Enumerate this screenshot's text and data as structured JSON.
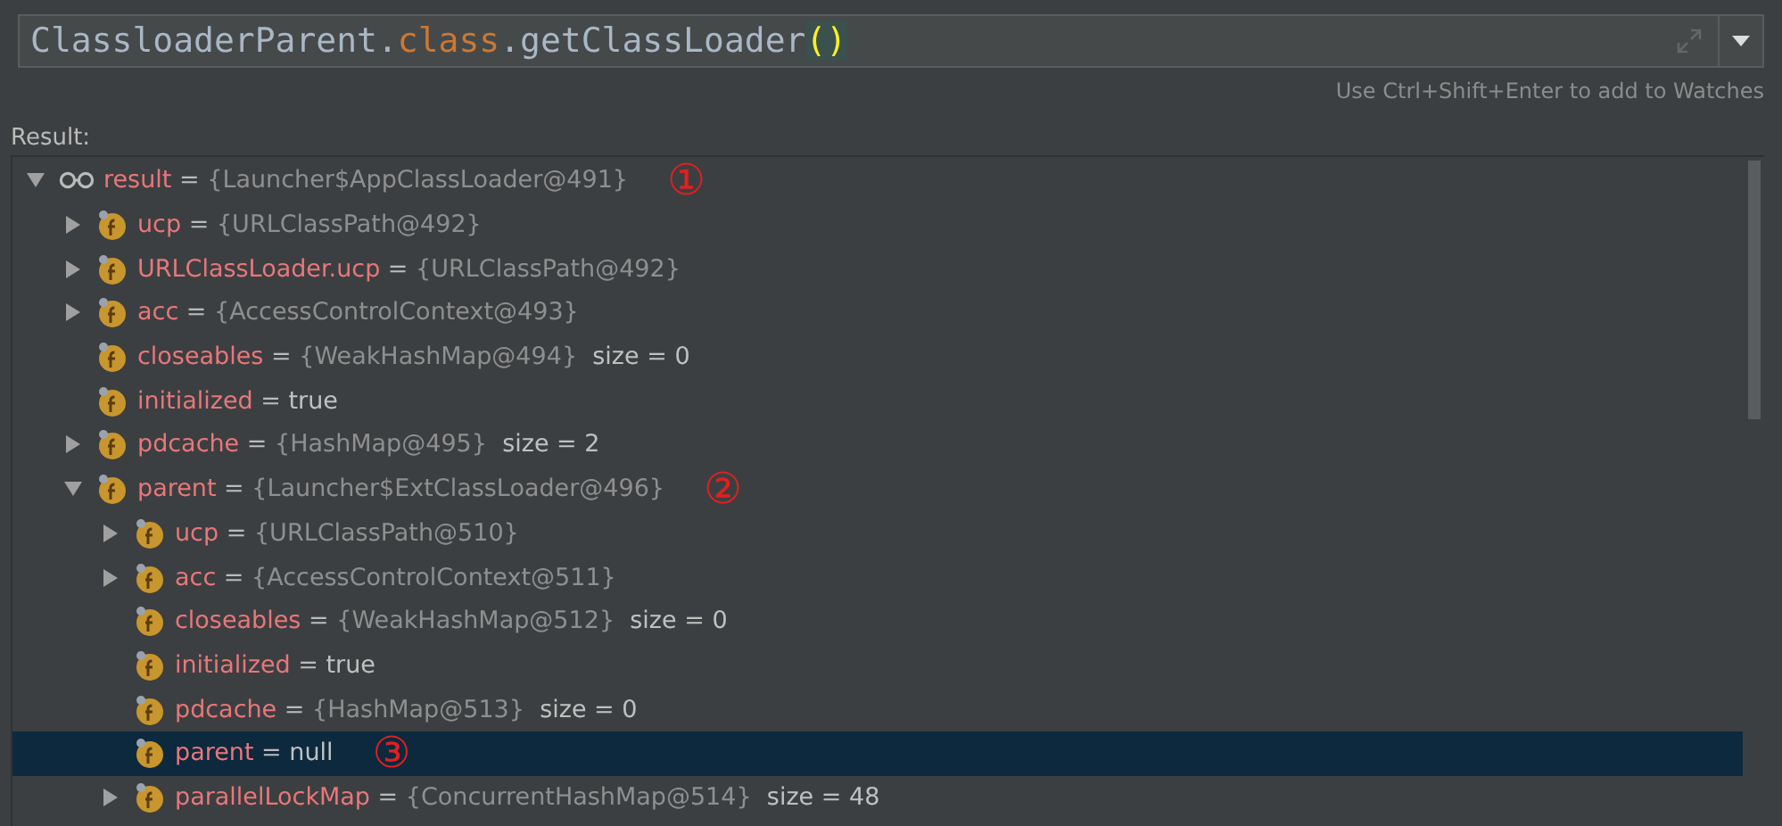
{
  "expression": {
    "parts": [
      {
        "text": "ClassloaderParent.",
        "kind": "plain"
      },
      {
        "text": "class",
        "kind": "keyword"
      },
      {
        "text": ".getClassLoader",
        "kind": "plain"
      },
      {
        "text": "()",
        "kind": "paren"
      }
    ]
  },
  "hint": "Use Ctrl+Shift+Enter to add to Watches",
  "result_label": "Result:",
  "tree": [
    {
      "kind": "watch",
      "name": "result",
      "op": "=",
      "value": "{Launcher$AppClassLoader@491}",
      "expanded": true,
      "selected": false,
      "annotation": "①",
      "children": [
        {
          "kind": "field",
          "name": "ucp",
          "op": "=",
          "value": "{URLClassPath@492}",
          "expanded": false,
          "selected": false
        },
        {
          "kind": "field",
          "name": "URLClassLoader.ucp",
          "op": "=",
          "value": "{URLClassPath@492}",
          "expanded": false,
          "selected": false
        },
        {
          "kind": "field",
          "name": "acc",
          "op": "=",
          "value": "{AccessControlContext@493}",
          "expanded": false,
          "selected": false
        },
        {
          "kind": "field",
          "name": "closeables",
          "op": "=",
          "value": "{WeakHashMap@494}",
          "extra": "size = 0",
          "selected": false
        },
        {
          "kind": "field",
          "name": "initialized",
          "op": "=",
          "value": "true",
          "selected": false
        },
        {
          "kind": "field",
          "name": "pdcache",
          "op": "=",
          "value": "{HashMap@495}",
          "extra": "size = 2",
          "expanded": false,
          "selected": false
        },
        {
          "kind": "field",
          "name": "parent",
          "op": "=",
          "value": "{Launcher$ExtClassLoader@496}",
          "expanded": true,
          "selected": false,
          "annotation": "②",
          "children": [
            {
              "kind": "field",
              "name": "ucp",
              "op": "=",
              "value": "{URLClassPath@510}",
              "expanded": false,
              "selected": false
            },
            {
              "kind": "field",
              "name": "acc",
              "op": "=",
              "value": "{AccessControlContext@511}",
              "expanded": false,
              "selected": false
            },
            {
              "kind": "field",
              "name": "closeables",
              "op": "=",
              "value": "{WeakHashMap@512}",
              "extra": "size = 0",
              "selected": false
            },
            {
              "kind": "field",
              "name": "initialized",
              "op": "=",
              "value": "true",
              "selected": false
            },
            {
              "kind": "field",
              "name": "pdcache",
              "op": "=",
              "value": "{HashMap@513}",
              "extra": "size = 0",
              "selected": false
            },
            {
              "kind": "field",
              "name": "parent",
              "op": "=",
              "value": "null",
              "selected": true,
              "annotation": "③"
            },
            {
              "kind": "field",
              "name": "parallelLockMap",
              "op": "=",
              "value": "{ConcurrentHashMap@514}",
              "extra": "size = 48",
              "expanded": false,
              "selected": false
            }
          ]
        }
      ]
    }
  ]
}
